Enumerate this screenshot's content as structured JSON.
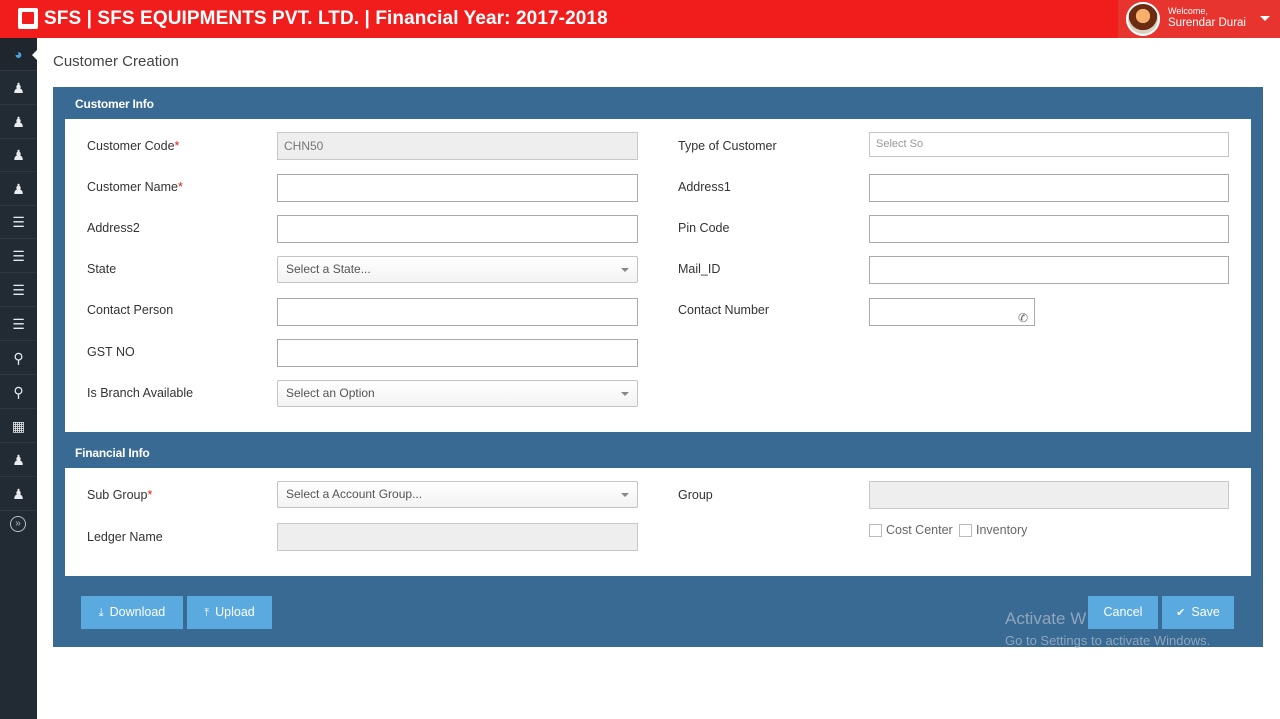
{
  "header": {
    "title": "SFS | SFS EQUIPMENTS PVT. LTD. | Financial Year: 2017-2018",
    "welcome": "Welcome,",
    "user_name": "Surendar Durai"
  },
  "sidebar": {
    "icons": [
      "dashboard-icon",
      "user-icon",
      "user-icon",
      "user-icon",
      "user-icon",
      "list-icon",
      "list-icon",
      "list-icon",
      "list-icon",
      "cart-icon",
      "cart-icon",
      "calendar-icon",
      "user-icon",
      "user-icon"
    ],
    "collapse_glyph": "»"
  },
  "page": {
    "title": "Customer Creation"
  },
  "customer_info": {
    "heading": "Customer Info",
    "customer_code_label": "Customer Code",
    "customer_code_value": "CHN50",
    "customer_name_label": "Customer Name",
    "address2_label": "Address2",
    "state_label": "State",
    "state_placeholder": "Select a State...",
    "contact_person_label": "Contact Person",
    "gst_label": "GST NO",
    "branch_label": "Is Branch Available",
    "branch_placeholder": "Select an Option",
    "type_label": "Type of Customer",
    "type_placeholder": "Select So",
    "address1_label": "Address1",
    "pin_label": "Pin Code",
    "mail_label": "Mail_ID",
    "contact_number_label": "Contact Number",
    "required_mark": "*"
  },
  "financial_info": {
    "heading": "Financial Info",
    "sub_group_label": "Sub Group",
    "sub_group_placeholder": "Select a Account Group...",
    "ledger_label": "Ledger Name",
    "group_label": "Group",
    "cost_center_label": "Cost Center",
    "inventory_label": "Inventory"
  },
  "actions": {
    "download": "Download",
    "upload": "Upload",
    "cancel": "Cancel",
    "save": "Save"
  },
  "watermark": {
    "line1": "Activate W",
    "line2": "Go to Settings to activate Windows."
  },
  "colors": {
    "topbar": "#f11d1d",
    "sidebar": "#222a33",
    "panel": "#396a93",
    "button": "#5aa9df"
  }
}
